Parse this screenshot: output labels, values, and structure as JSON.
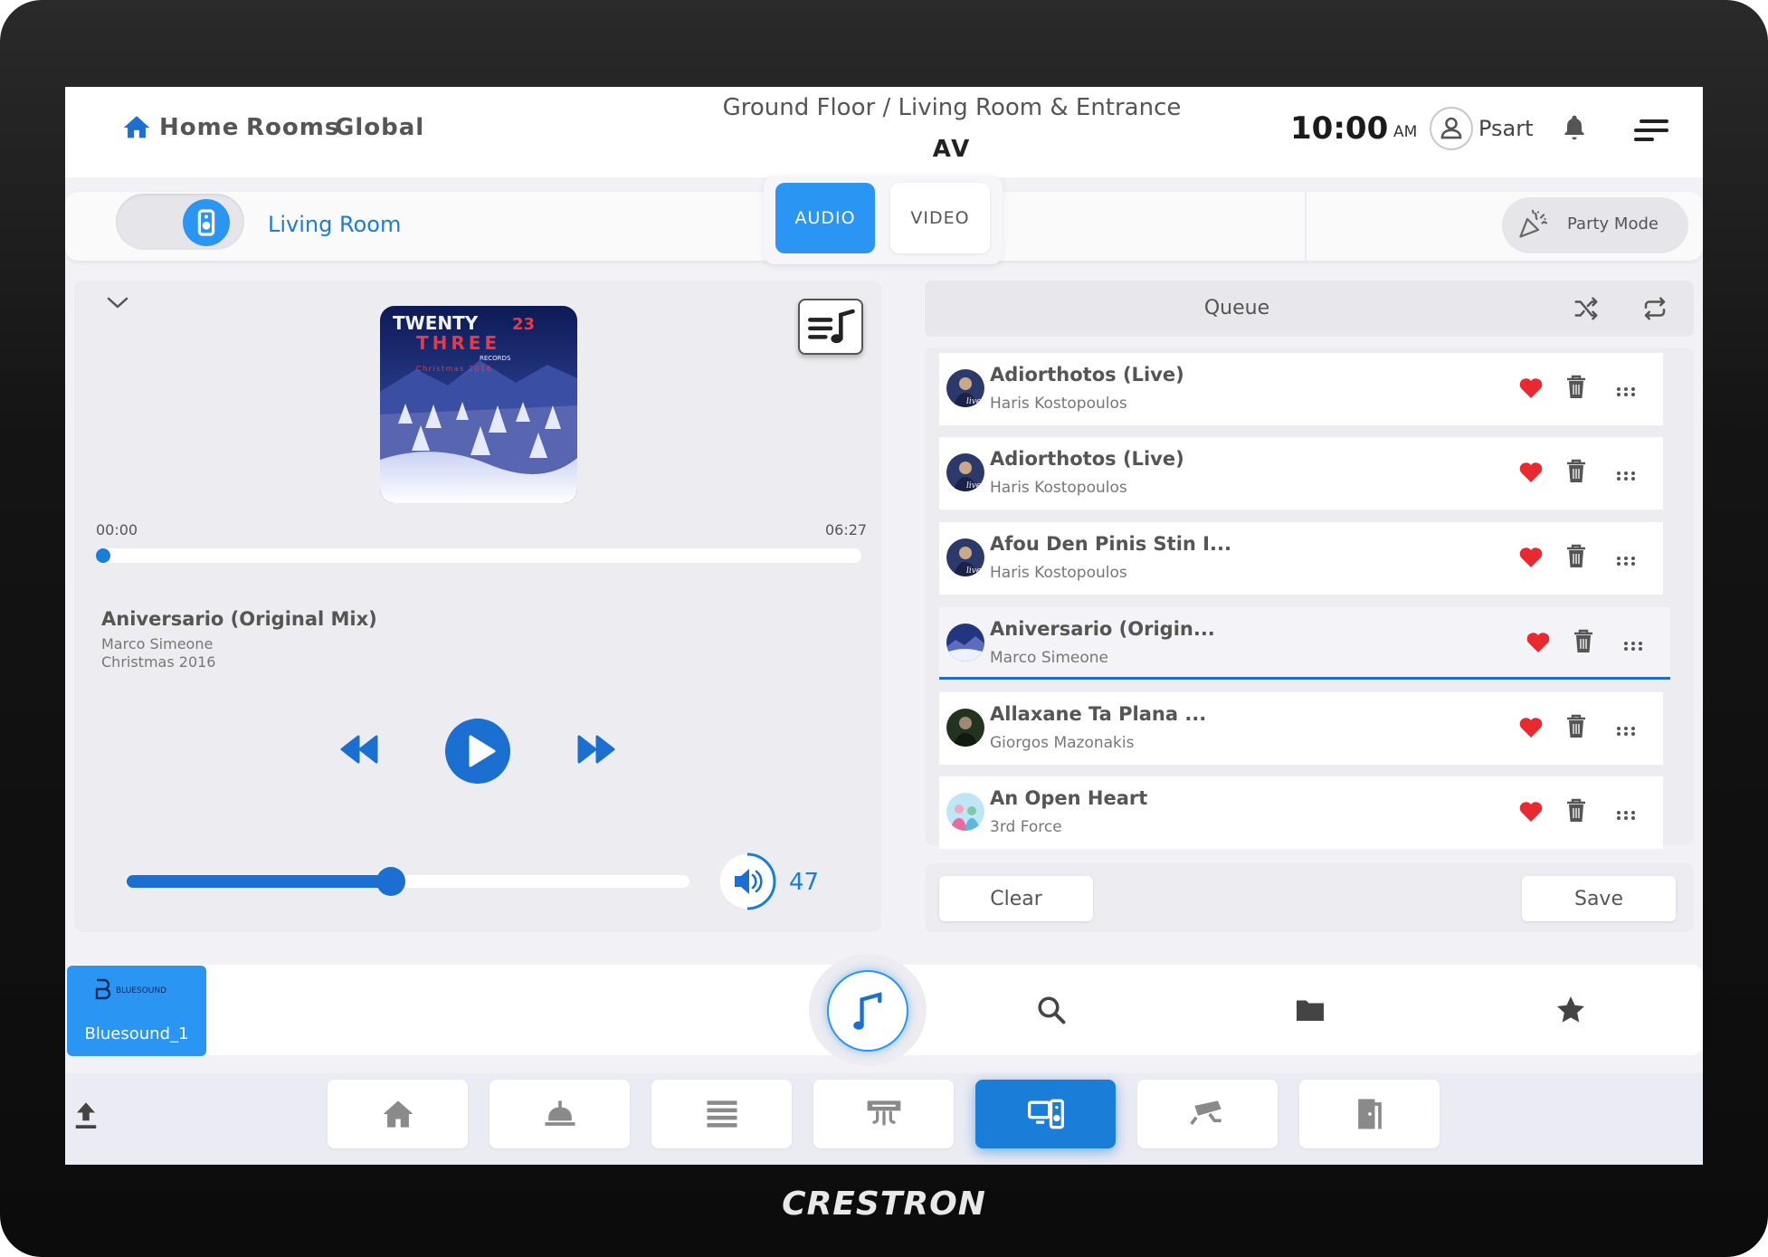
{
  "brand": "CRESTRON",
  "header": {
    "nav": {
      "home": "Home",
      "rooms": "Rooms",
      "global": "Global"
    },
    "breadcrumb": "Ground Floor / Living Room & Entrance",
    "title": "AV",
    "time": "10:00",
    "ampm": "AM",
    "user": "Psart"
  },
  "roombar": {
    "room": "Living Room",
    "tabs": {
      "audio": "AUDIO",
      "video": "VIDEO"
    },
    "party_mode": "Party Mode"
  },
  "player": {
    "elapsed": "00:00",
    "duration": "06:27",
    "progress_fraction": 0.0,
    "title": "Aniversario (Original Mix)",
    "artist": "Marco Simeone",
    "album": "Christmas 2016",
    "album_art_text": {
      "line1": "TWENTY",
      "line1b": "23",
      "line2": "THREE",
      "line3": "RECORDS",
      "line4": "Christmas 2016"
    },
    "volume": 47
  },
  "queue": {
    "title": "Queue",
    "items": [
      {
        "title": "Adiorthotos (Live)",
        "artist": "Haris Kostopoulos",
        "thumb": "live",
        "favorite": true
      },
      {
        "title": "Adiorthotos (Live)",
        "artist": "Haris Kostopoulos",
        "thumb": "live",
        "favorite": true
      },
      {
        "title": "Afou Den Pinis Stin I...",
        "artist": "Haris Kostopoulos",
        "thumb": "live",
        "favorite": true
      },
      {
        "title": "Aniversario (Origin...",
        "artist": "Marco Simeone",
        "thumb": "snow",
        "favorite": true,
        "playing": true
      },
      {
        "title": "Allaxane Ta Plana ...",
        "artist": "Giorgos Mazonakis",
        "thumb": "dark",
        "favorite": true
      },
      {
        "title": "An Open Heart",
        "artist": "3rd Force",
        "thumb": "light",
        "favorite": true
      }
    ],
    "clear": "Clear",
    "save": "Save"
  },
  "source": {
    "logo_text": "BLUESOUND",
    "name": "Bluesound_1"
  },
  "colors": {
    "accent": "#2a95f3",
    "accent_dark": "#1a6fd0",
    "heart": "#e8292f",
    "screen_bg": "#f1f1f6"
  },
  "icons": {
    "source_tabs": [
      "music-note-icon",
      "search-icon",
      "folder-icon",
      "star-icon"
    ],
    "bottom_nav": [
      "home-icon",
      "light-icon",
      "shades-icon",
      "climate-icon",
      "av-icon",
      "camera-icon",
      "door-icon"
    ]
  }
}
